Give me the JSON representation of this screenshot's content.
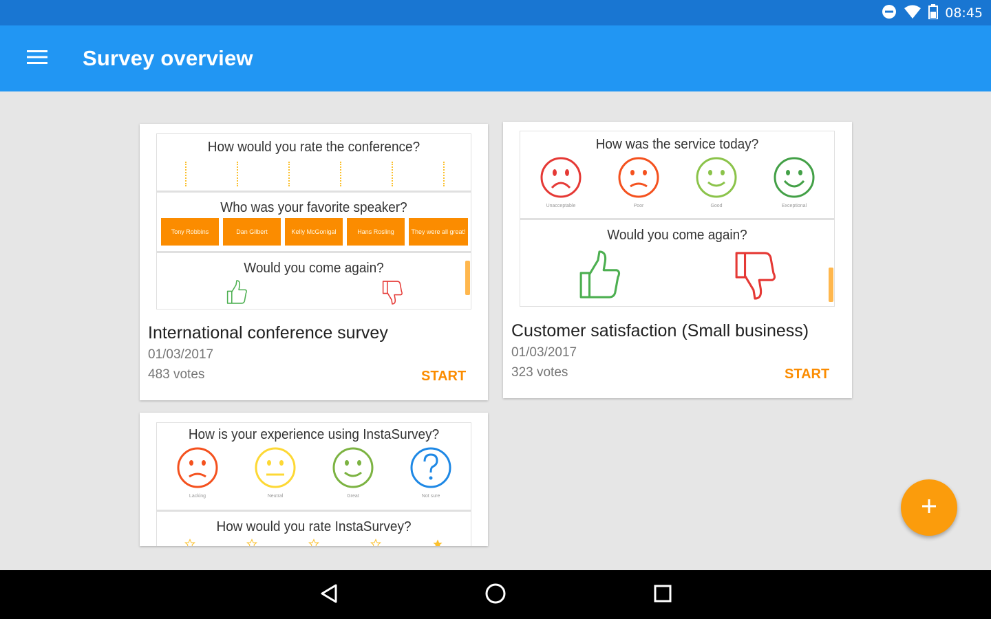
{
  "status_bar": {
    "time": "08:45",
    "icons": [
      "do-not-disturb-icon",
      "wifi-icon",
      "battery-icon"
    ]
  },
  "app_bar": {
    "title": "Survey overview",
    "menu_icon": "hamburger-menu-icon"
  },
  "colors": {
    "status_bar": "#1976d2",
    "app_bar": "#2196f3",
    "accent": "#fb8c00",
    "background": "#e6e6e6"
  },
  "surveys": [
    {
      "title": "International conference survey",
      "date": "01/03/2017",
      "votes": "483 votes",
      "start_label": "START",
      "preview": {
        "q1": "How would you rate the conference?",
        "q2": "Who was your favorite speaker?",
        "speakers": [
          "Tony Robbins",
          "Dan Gilbert",
          "Kelly McGonigal",
          "Hans Rosling",
          "They were all great!"
        ],
        "q3": "Would you come again?"
      }
    },
    {
      "title": "Customer satisfaction (Small business)",
      "date": "01/03/2017",
      "votes": "323 votes",
      "start_label": "START",
      "preview": {
        "q1": "How was the service today?",
        "faces": [
          "Unacceptable",
          "Poor",
          "Good",
          "Exceptional"
        ],
        "q2": "Would you come again?"
      }
    },
    {
      "preview": {
        "q1": "How is your experience using InstaSurvey?",
        "faces": [
          "Lacking",
          "Neutral",
          "Great",
          "Not sure"
        ],
        "q2": "How would you rate InstaSurvey?"
      }
    }
  ],
  "fab": {
    "icon": "plus-icon"
  },
  "nav_bar": {
    "icons": [
      "back-icon",
      "home-icon",
      "recents-icon"
    ]
  }
}
